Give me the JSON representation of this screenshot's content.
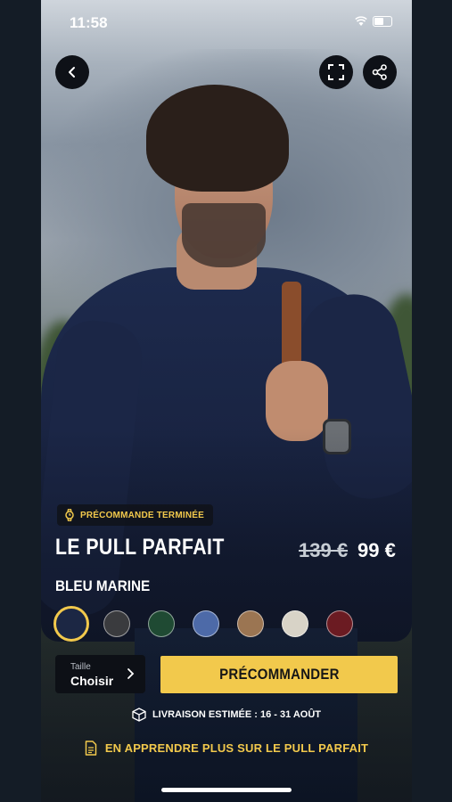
{
  "status_bar": {
    "time": "11:58"
  },
  "badge": {
    "text": "PRÉCOMMANDE TERMINÉE"
  },
  "product": {
    "name": "LE PULL PARFAIT",
    "old_price": "139 €",
    "price": "99 €",
    "color_name": "BLEU MARINE"
  },
  "swatches": [
    {
      "name": "bleu-marine",
      "color": "#1c2744",
      "selected": true
    },
    {
      "name": "gris-anthracite",
      "color": "#3a3b3e",
      "selected": false
    },
    {
      "name": "vert",
      "color": "#1f4a33",
      "selected": false
    },
    {
      "name": "bleu-clair",
      "color": "#4d6aa8",
      "selected": false
    },
    {
      "name": "camel",
      "color": "#9b7552",
      "selected": false
    },
    {
      "name": "ecru",
      "color": "#d8d3c7",
      "selected": false
    },
    {
      "name": "bordeaux",
      "color": "#6b1b22",
      "selected": false
    }
  ],
  "size_selector": {
    "label": "Taille",
    "value": "Choisir"
  },
  "cta": {
    "label": "PRÉCOMMANDER"
  },
  "delivery": {
    "text": "LIVRAISON ESTIMÉE : 16 - 31 AOÛT"
  },
  "learn_more": {
    "text": "EN APPRENDRE PLUS SUR LE PULL PARFAIT"
  },
  "colors": {
    "accent": "#f2c94c",
    "dark": "#0e1117"
  }
}
